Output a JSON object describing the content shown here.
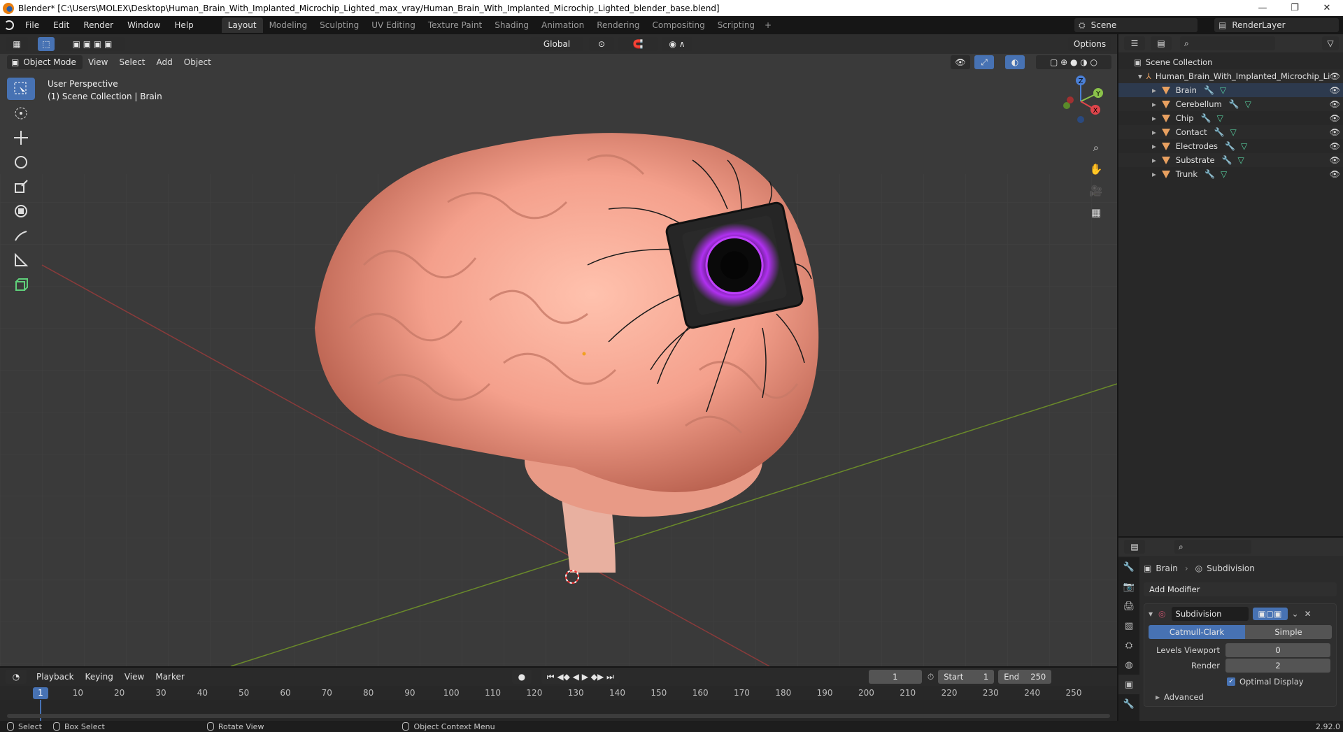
{
  "window": {
    "title": "Blender* [C:\\Users\\MOLEX\\Desktop\\Human_Brain_With_Implanted_Microchip_Lighted_max_vray/Human_Brain_With_Implanted_Microchip_Lighted_blender_base.blend]",
    "minimize": "—",
    "maximize": "❐",
    "close": "✕"
  },
  "menu": [
    "File",
    "Edit",
    "Render",
    "Window",
    "Help"
  ],
  "workspaces": [
    "Layout",
    "Modeling",
    "Sculpting",
    "UV Editing",
    "Texture Paint",
    "Shading",
    "Animation",
    "Rendering",
    "Compositing",
    "Scripting"
  ],
  "workspace_add": "+",
  "scene": {
    "name": "Scene",
    "render_layer": "RenderLayer"
  },
  "viewport": {
    "mode": "Object Mode",
    "menus": [
      "View",
      "Select",
      "Add",
      "Object"
    ],
    "orientation": "Global",
    "options_label": "Options",
    "info_line1": "User Perspective",
    "info_line2": "(1) Scene Collection | Brain",
    "gizmo_axes": {
      "z": "Z",
      "y": "Y",
      "x": "X"
    }
  },
  "outliner": {
    "root": "Scene Collection",
    "collection": "Human_Brain_With_Implanted_Microchip_Li",
    "objects": [
      "Brain",
      "Cerebellum",
      "Chip",
      "Contact",
      "Electrodes",
      "Substrate",
      "Trunk"
    ]
  },
  "properties": {
    "object_name": "Brain",
    "modifier_breadcrumb": "Subdivision",
    "add_modifier": "Add Modifier",
    "modifier_name": "Subdivision",
    "mode_catmull": "Catmull-Clark",
    "mode_simple": "Simple",
    "levels_viewport_label": "Levels Viewport",
    "levels_viewport_value": "0",
    "render_label": "Render",
    "render_value": "2",
    "optimal_display": "Optimal Display",
    "advanced": "Advanced"
  },
  "timeline": {
    "menus": [
      "Playback",
      "Keying",
      "View",
      "Marker"
    ],
    "current_frame": "1",
    "start_label": "Start",
    "start": "1",
    "end_label": "End",
    "end": "250",
    "playhead": "1",
    "ticks": [
      "10",
      "20",
      "30",
      "40",
      "50",
      "60",
      "70",
      "80",
      "90",
      "100",
      "110",
      "120",
      "130",
      "140",
      "150",
      "160",
      "170",
      "180",
      "190",
      "200",
      "210",
      "220",
      "230",
      "240",
      "250"
    ]
  },
  "status": {
    "select": "Select",
    "box_select": "Box Select",
    "rotate_view": "Rotate View",
    "context_menu": "Object Context Menu",
    "version": "2.92.0"
  },
  "colors": {
    "accent": "#4772b3",
    "viewport_bg": "#3a3a3a",
    "brain": "#f0a590",
    "chip_glow": "#c040ff"
  }
}
